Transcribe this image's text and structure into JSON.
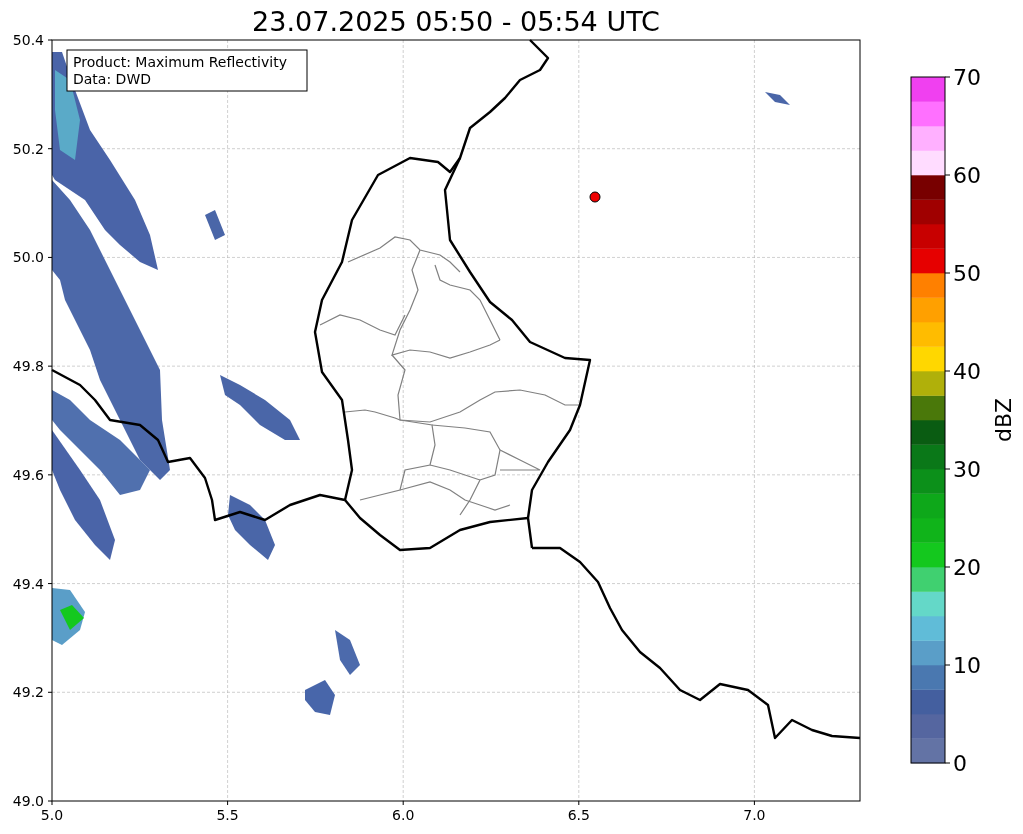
{
  "title": "23.07.2025 05:50 - 05:54 UTC",
  "map": {
    "legend": [
      "Product: Maximum Reflectivity",
      "Data: DWD"
    ],
    "xticks": [
      "5.0",
      "5.5",
      "6.0",
      "6.5",
      "7.0"
    ],
    "yticks": [
      "50.4",
      "50.2",
      "50.0",
      "49.8",
      "49.6",
      "49.4",
      "49.2",
      "49.0"
    ]
  },
  "colorbar": {
    "label": "dBZ",
    "ticks": [
      "70",
      "60",
      "50",
      "40",
      "30",
      "20",
      "10",
      "0"
    ],
    "segments": [
      {
        "color": "#6373a5"
      },
      {
        "color": "#5566a0"
      },
      {
        "color": "#445f9f"
      },
      {
        "color": "#4a78b0"
      },
      {
        "color": "#5a9ec8"
      },
      {
        "color": "#60bcd8"
      },
      {
        "color": "#64d8c8"
      },
      {
        "color": "#40d070"
      },
      {
        "color": "#14c81e"
      },
      {
        "color": "#10b41a"
      },
      {
        "color": "#0ea81a"
      },
      {
        "color": "#0c901a"
      },
      {
        "color": "#0a7818"
      },
      {
        "color": "#0a5c12"
      },
      {
        "color": "#4a780a"
      },
      {
        "color": "#b0b00a"
      },
      {
        "color": "#ffd700"
      },
      {
        "color": "#ffbc00"
      },
      {
        "color": "#ffa000"
      },
      {
        "color": "#ff8000"
      },
      {
        "color": "#e60000"
      },
      {
        "color": "#c80000"
      },
      {
        "color": "#a00000"
      },
      {
        "color": "#780000"
      },
      {
        "color": "#ffdcff"
      },
      {
        "color": "#ffb0ff"
      },
      {
        "color": "#ff70ff"
      },
      {
        "color": "#f040f0"
      }
    ]
  }
}
